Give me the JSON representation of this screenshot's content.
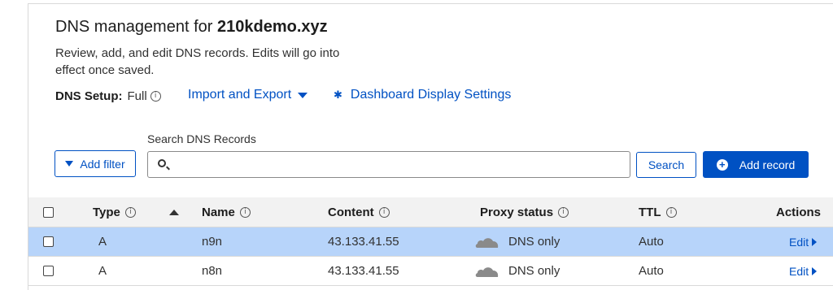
{
  "header": {
    "title_prefix": "DNS management for ",
    "domain": "210kdemo.xyz",
    "description": "Review, add, and edit DNS records. Edits will go into effect once saved.",
    "setup_label": "DNS Setup:",
    "setup_value": "Full"
  },
  "links": {
    "import_export": "Import and Export",
    "dashboard_settings": "Dashboard Display Settings"
  },
  "search": {
    "label": "Search DNS Records",
    "value": "",
    "placeholder": ""
  },
  "buttons": {
    "add_filter": "Add filter",
    "search": "Search",
    "add_record": "Add record"
  },
  "table": {
    "columns": {
      "type": "Type",
      "name": "Name",
      "content": "Content",
      "proxy": "Proxy status",
      "ttl": "TTL",
      "actions": "Actions"
    },
    "rows": [
      {
        "type": "A",
        "name": "n9n",
        "content": "43.133.41.55",
        "proxy": "DNS only",
        "ttl": "Auto",
        "action": "Edit",
        "selected": true
      },
      {
        "type": "A",
        "name": "n8n",
        "content": "43.133.41.55",
        "proxy": "DNS only",
        "ttl": "Auto",
        "action": "Edit",
        "selected": false
      }
    ]
  },
  "colors": {
    "accent": "#0051c3",
    "selected_row": "#b7d4fa",
    "header_row": "#f2f2f2"
  }
}
